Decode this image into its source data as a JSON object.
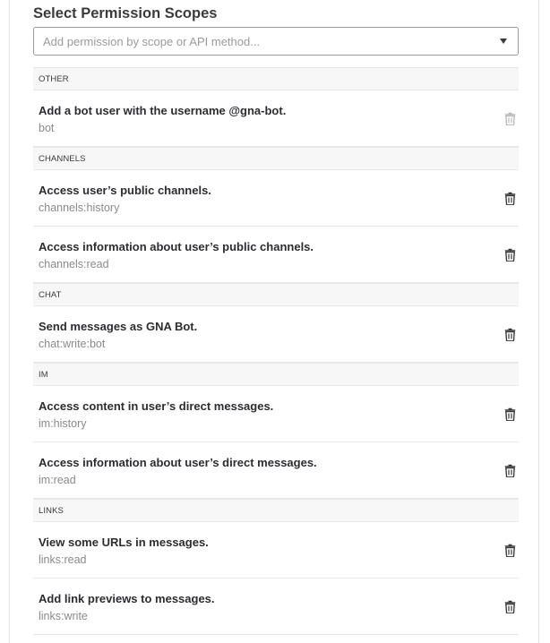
{
  "header": {
    "title": "Select Permission Scopes"
  },
  "search": {
    "placeholder": "Add permission by scope or API method..."
  },
  "sections": [
    {
      "label": "OTHER",
      "items": [
        {
          "description": "Add a bot user with the username @gna-bot.",
          "scope": "bot",
          "removable": false
        }
      ]
    },
    {
      "label": "CHANNELS",
      "items": [
        {
          "description": "Access user’s public channels.",
          "scope": "channels:history",
          "removable": true
        },
        {
          "description": "Access information about user’s public channels.",
          "scope": "channels:read",
          "removable": true
        }
      ]
    },
    {
      "label": "CHAT",
      "items": [
        {
          "description": "Send messages as GNA Bot.",
          "scope": "chat:write:bot",
          "removable": true
        }
      ]
    },
    {
      "label": "IM",
      "items": [
        {
          "description": "Access content in user’s direct messages.",
          "scope": "im:history",
          "removable": true
        },
        {
          "description": "Access information about user’s direct messages.",
          "scope": "im:read",
          "removable": true
        }
      ]
    },
    {
      "label": "LINKS",
      "items": [
        {
          "description": "View some URLs in messages.",
          "scope": "links:read",
          "removable": true
        },
        {
          "description": "Add link previews to messages.",
          "scope": "links:write",
          "removable": true
        }
      ]
    }
  ],
  "colors": {
    "text": "#2c2d30",
    "muted": "#8a8a8a",
    "section_bg": "#f7f7f7",
    "border": "#e8e8e8"
  },
  "icons": {
    "remove": "trash-icon",
    "dropdown": "chevron-down-icon"
  }
}
